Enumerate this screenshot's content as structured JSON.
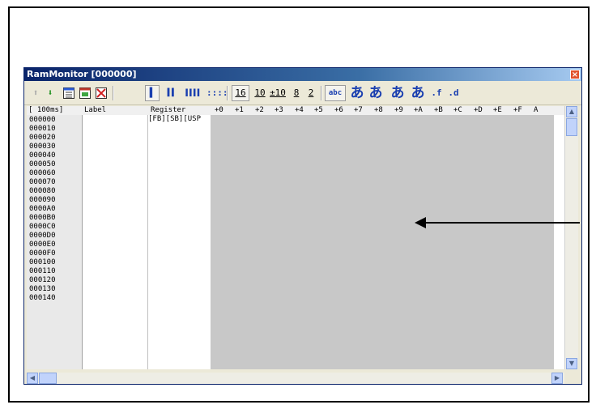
{
  "window": {
    "title": "RamMonitor [000000]",
    "close_glyph": "×"
  },
  "toolbar": {
    "up_arrow_glyph": "⬆",
    "down_arrow_glyph": "⬇",
    "width_1": "▌",
    "width_2": "▌▌",
    "width_4": "▌▌▌▌",
    "width_8": "::::",
    "radix_16": "16",
    "radix_10": "10",
    "radix_pm10": "±10",
    "radix_8": "8",
    "radix_2": "2",
    "ascii": "abc",
    "sjis": "あ",
    "jis": "あ",
    "euc": "あ",
    "unicode": "あ",
    "float": ".f",
    "double": ".d"
  },
  "grid": {
    "header": {
      "interval": "[  100ms]",
      "label": "Label",
      "register": "Register",
      "offsets": [
        "+0",
        "+1",
        "+2",
        "+3",
        "+4",
        "+5",
        "+6",
        "+7",
        "+8",
        "+9",
        "+A",
        "+B",
        "+C",
        "+D",
        "+E",
        "+F",
        "A"
      ]
    },
    "register_row0": "[FB][SB][USP",
    "addresses": [
      "000000",
      "000010",
      "000020",
      "000030",
      "000040",
      "000050",
      "000060",
      "000070",
      "000080",
      "000090",
      "0000A0",
      "0000B0",
      "0000C0",
      "0000D0",
      "0000E0",
      "0000F0",
      "000100",
      "000110",
      "000120",
      "000130",
      "000140"
    ]
  },
  "icons": {
    "up": "arrow-up-icon",
    "down": "arrow-down-icon",
    "settings": "layout-settings-icon",
    "sample": "sample-period-icon",
    "clear": "clear-icon"
  },
  "colors": {
    "title_start": "#0a246a",
    "title_end": "#a6caf0",
    "data_area": "#c8c8c8",
    "address_bg": "#e9e9e9"
  }
}
